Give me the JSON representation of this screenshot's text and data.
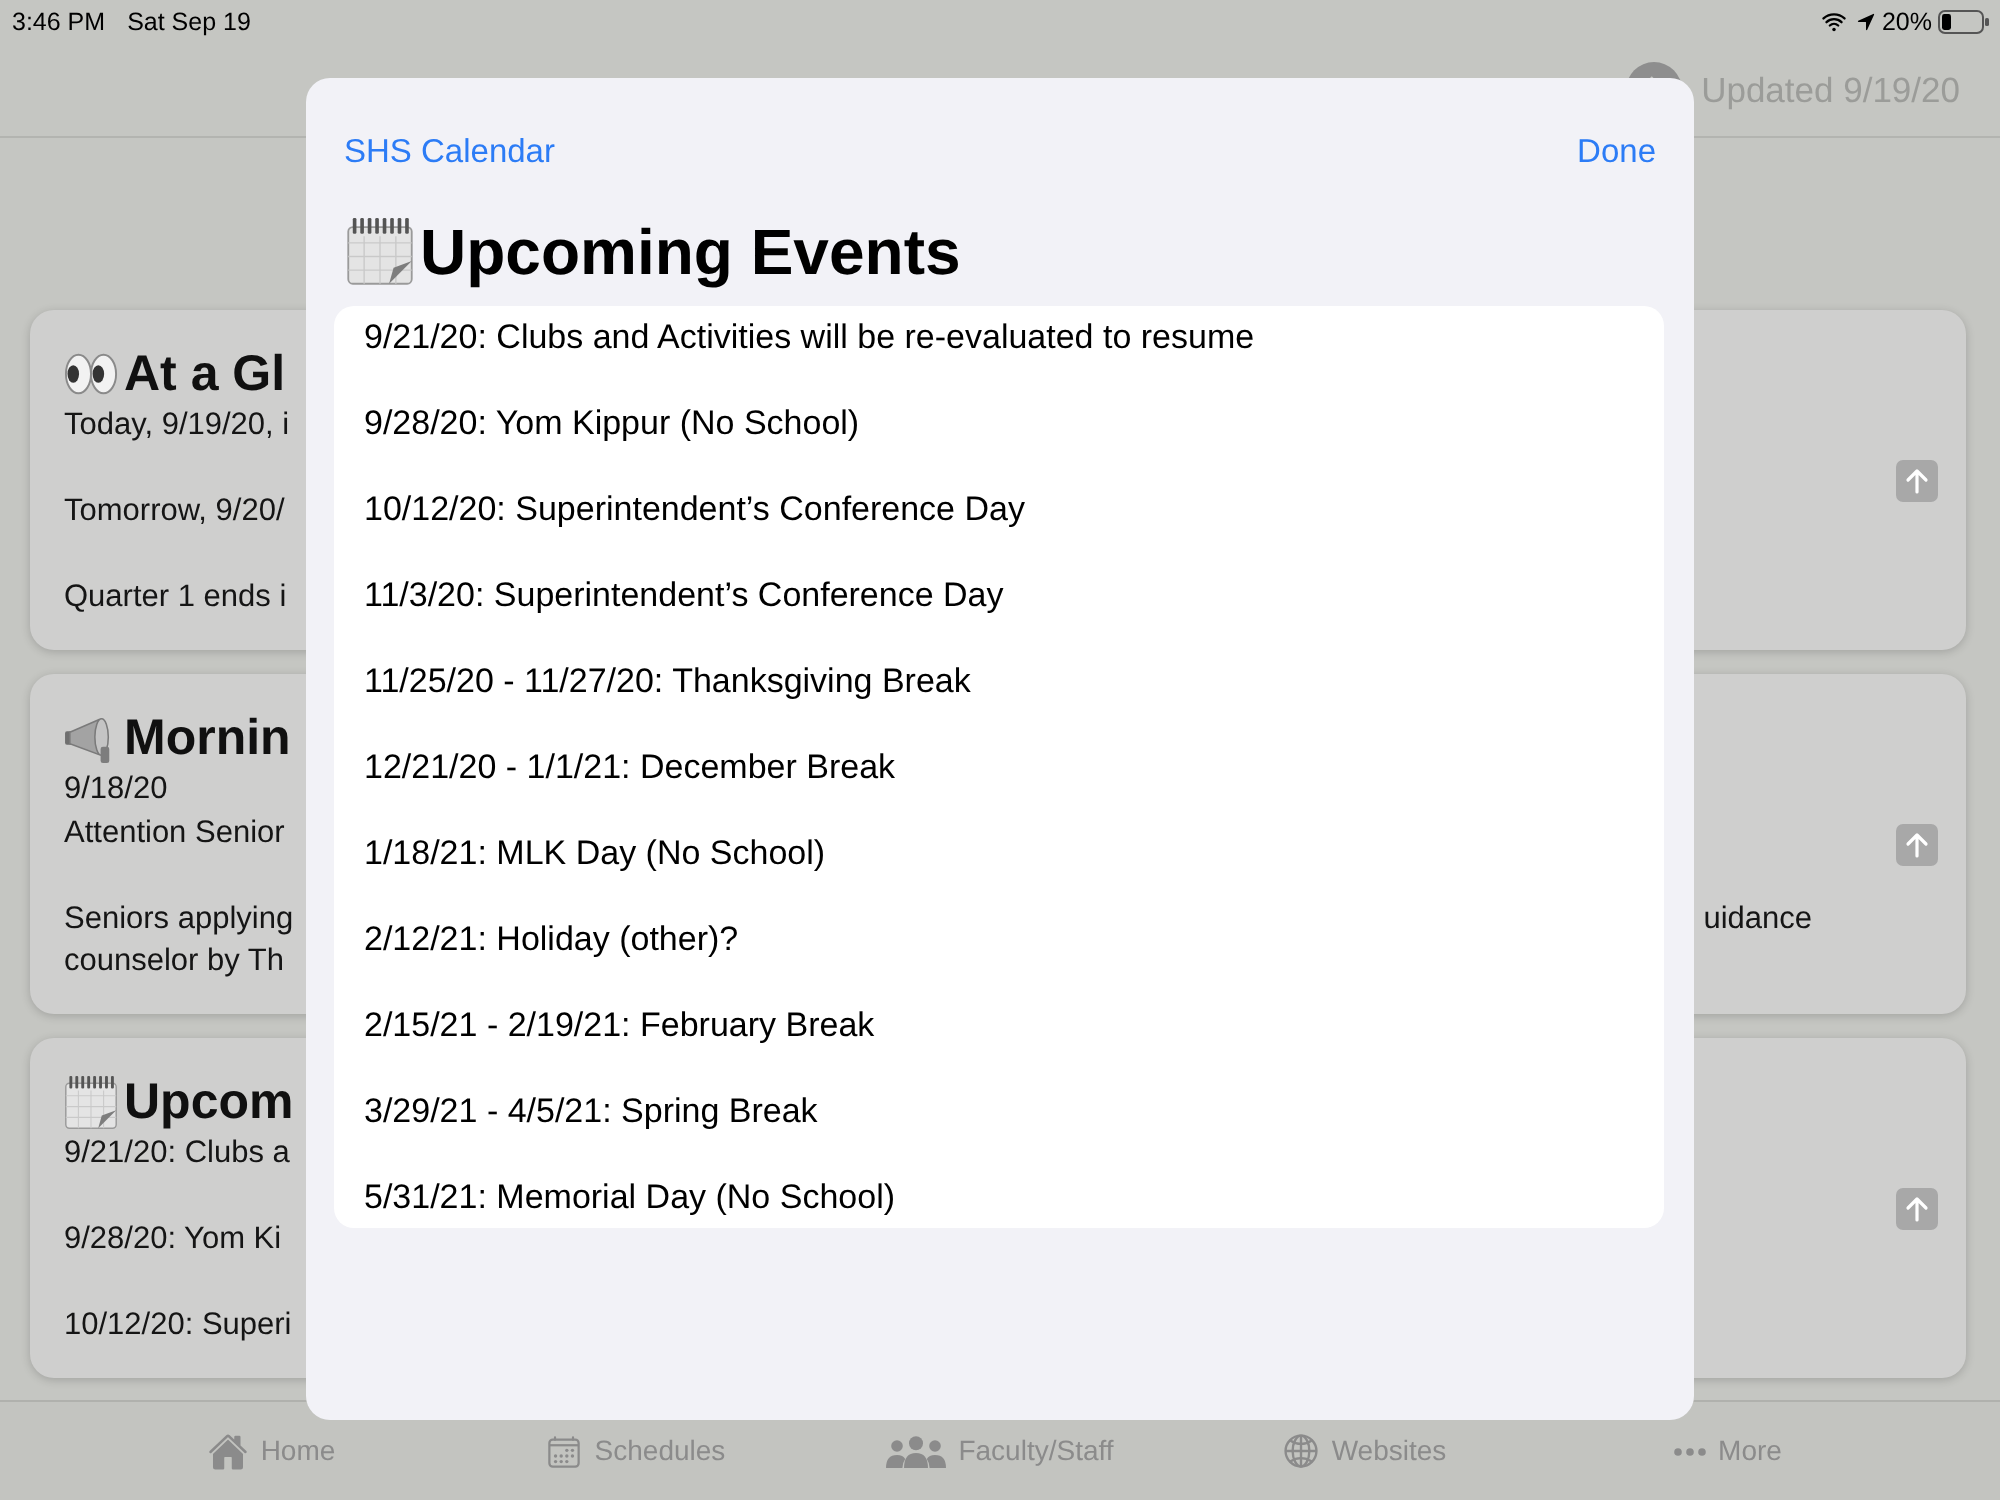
{
  "status_bar": {
    "time": "3:46 PM",
    "date": "Sat Sep 19",
    "battery_text": "20%"
  },
  "header": {
    "updated": "Updated 9/19/20"
  },
  "cards": [
    {
      "kind": "eyes",
      "title": "At a Gl",
      "paragraphs": [
        [
          {
            "text": "Today, 9/19/20, i"
          }
        ],
        [
          {
            "text": "Tomorrow, 9/20/"
          }
        ],
        [
          {
            "text": "Quarter 1 ends i"
          }
        ]
      ]
    },
    {
      "kind": "megaphone",
      "title": "Mornin",
      "paragraphs": [
        [
          {
            "text": "9/18/20"
          },
          {
            "text": "Attention Senior"
          }
        ],
        [
          {
            "text": "Seniors applying",
            "tail": "uidance"
          },
          {
            "text": "counselor by Th"
          }
        ]
      ]
    },
    {
      "kind": "calendar",
      "title": "Upcom",
      "paragraphs": [
        [
          {
            "text": "9/21/20: Clubs a"
          }
        ],
        [
          {
            "text": "9/28/20: Yom Ki"
          }
        ],
        [
          {
            "text": "10/12/20: Superi"
          }
        ]
      ]
    }
  ],
  "sheet": {
    "link": "SHS Calendar",
    "done": "Done",
    "title": "Upcoming Events",
    "events": [
      "9/21/20: Clubs and Activities will be re-evaluated to resume",
      "9/28/20: Yom Kippur (No School)",
      "10/12/20: Superintendent’s Conference Day",
      "11/3/20: Superintendent’s Conference Day",
      "11/25/20 - 11/27/20: Thanksgiving Break",
      "12/21/20 - 1/1/21: December Break",
      "1/18/21: MLK Day (No School)",
      "2/12/21: Holiday (other)?",
      "2/15/21 - 2/19/21: February Break",
      "3/29/21 - 4/5/21: Spring Break",
      "5/31/21: Memorial Day (No School)"
    ]
  },
  "tab_bar": [
    {
      "kind": "home",
      "label": "Home"
    },
    {
      "kind": "calendar",
      "label": "Schedules"
    },
    {
      "kind": "people",
      "label": "Faculty/Staff"
    },
    {
      "kind": "globe",
      "label": "Websites"
    },
    {
      "kind": "more",
      "label": "More"
    }
  ]
}
